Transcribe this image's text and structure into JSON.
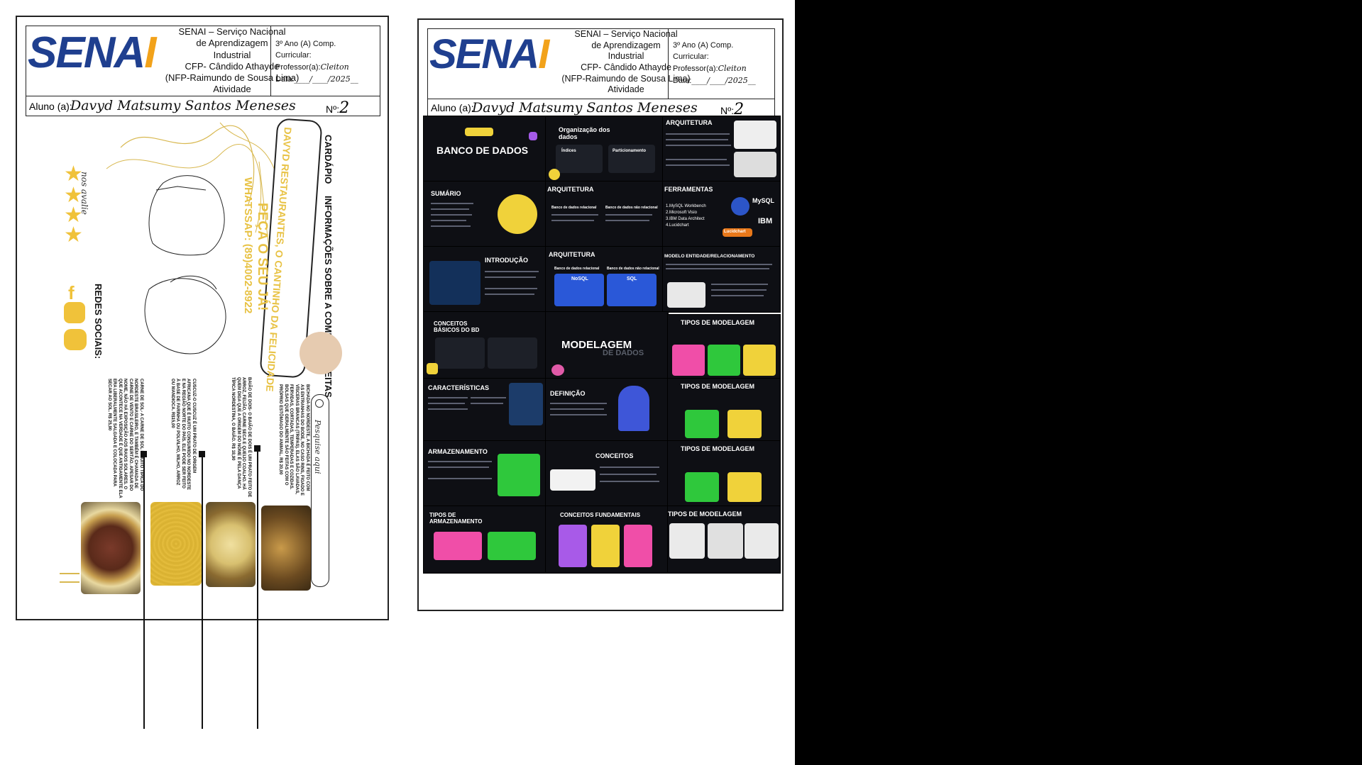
{
  "left_page": {
    "header": {
      "logo": "SENAI",
      "institution_lines": [
        "SENAI – Serviço Nacional",
        "de Aprendizagem",
        "Industrial",
        "CFP- Cândido Athayde",
        "(NFP-Raimundo de Sousa Lima)",
        "Atividade"
      ],
      "grade": "3º Ano (A) Comp.",
      "curriculum": "Curricular:",
      "teacher_label": "Professor(a):",
      "teacher": "Cleiton",
      "date_label": "Data:",
      "date_value": "____/____/2025__"
    },
    "student": {
      "label": "Aluno (a):",
      "name": "Davyd Matsumy Santos Meneses",
      "number_label": "Nº:",
      "number": "2"
    }
  },
  "menu": {
    "tabs": [
      "CARDÁPIO",
      "INFORMAÇÕES SOBRE A COMIDA",
      "RECEITAS"
    ],
    "ribbon": "DAVYD RESTAURANTES, O CANTINHO DA FELICIDADE",
    "order": "PEÇA O SEU JÁ!",
    "whatsapp": "WHATSSAP: (89)4002-8922",
    "rate": "nos avalie",
    "social": "REDES SOCIAIS:",
    "search": "Pesquise aqui",
    "dishes": [
      {
        "text": "BICHADA-NO NORDESTE, A BICHADA É FEITO COM AS ENTRANHAS DO BODE, NO CASO RINS, FIGADO E VÍSCERAS BRANCAS (TRIPAS). ELAS SÃO LAVADAS, FERVIDAS, CORTADAS, TEMPERADAS E COZIDAS. BOLSAS QUE GERALMENTE SÃO FEITAS COM O PRÓPRIO ESTÔMAGO DO ANIMAL.",
        "price": "R$ 20,00"
      },
      {
        "text": "BAIÃO DE DOIS- O BAIÃO DE DOIS É UM PRATO FEITO DE ARROZ, FEIJÃO, CARNE SECA E QUEIJO COALHO. HÁ QUEM DIGA QUE A ORIGEM DO NOME É PELA DANÇA TÍPICA NORDESTINA, O BAIÃO.",
        "price": "R$ 18,90"
      },
      {
        "text": "CUSCUZ-O CUSCUZ É UM PRATO DE ORIGEM AFRICANA QUE É MUITO CONSUMIDO NO NORDESTE E NA REGIÃO NORTE DO PAÍS. ELE PODE SER FEITO À BASE DE FARINHA OU POLVILHO, MILHO, ARROZ OU MANDIOCA.",
        "price": "R$15,00"
      },
      {
        "text": "CARNE DE SOL- A CARNE DE SOL É MUITO TÍPICA DO NORDESTE BRASILEIRO, E TAMBÉM É CHAMADA DE CARNE DE VENTO E CARNE DO SERTÃO. APESAR DO NOME, NÃO HÁ EXPOSIÇÃO AOS RAIOS SOLARES. O QUE ACONTECE NA VERDADE É QUE ANTIGAMENTE ELA ERA LIBERALMENTE SALGADA E COLOCADA PARA SECAR AO SOL.",
        "price": "R$ 25,90"
      }
    ]
  },
  "right_page": {
    "header": {
      "logo": "SENAI",
      "institution_lines": [
        "SENAI – Serviço Nacional",
        "de Aprendizagem",
        "Industrial",
        "CFP- Cândido Athayde",
        "(NFP-Raimundo de Sousa Lima)",
        "Atividade"
      ],
      "grade": "3º Ano (A) Comp.",
      "curriculum": "Curricular:",
      "teacher_label": "Professor(a):",
      "teacher": "Cleiton",
      "date_label": "Data:",
      "date_value": "____/____/2025__"
    },
    "student": {
      "label": "Aluno (a):",
      "name": "Davyd Matsumy Santos Meneses",
      "number_label": "Nº:",
      "number": "2"
    }
  },
  "slides": {
    "banco": "BANCO DE DADOS",
    "organizacao": "Organização dos dados",
    "org_a": "Índices",
    "org_b": "Particionamento",
    "arquitetura": "ARQUITETURA",
    "sumario": "SUMÁRIO",
    "ferramentas": "FERRAMENTAS",
    "tools": [
      "1.MySQL Workbench",
      "2.Microsoft Visio",
      "3.IBM Data Architect",
      "4.Lucidchart"
    ],
    "tool_logos": [
      "MySQL",
      "IBM",
      "Lucidchart"
    ],
    "introducao": "INTRODUÇÃO",
    "arq_blocks": [
      "Banco de dados relacional",
      "Banco de dados não relacional"
    ],
    "arq3_blocks": [
      "Banco de dados não relacional",
      "Banco de dados relacional"
    ],
    "arq3_logos": [
      "NoSQL",
      "SQL"
    ],
    "modelo": "MODELO ENTIDADE/RELACIONAMENTO",
    "conceitos_bd": "CONCEITOS BÁSICOS DO BD",
    "modelagem": "MODELAGEM",
    "modelagem_sub": "DE DADOS",
    "tipos": "TIPOS DE MODELAGEM",
    "caracteristicas": "CARACTERÍSTICAS",
    "definicao": "DEFINIÇÃO",
    "armazenamento": "ARMAZENAMENTO",
    "conceitos": "CONCEITOS",
    "tipos_arm": "TIPOS DE ARMAZENAMENTO",
    "conceitos_fund": "CONCEITOS FUNDAMENTAIS"
  }
}
